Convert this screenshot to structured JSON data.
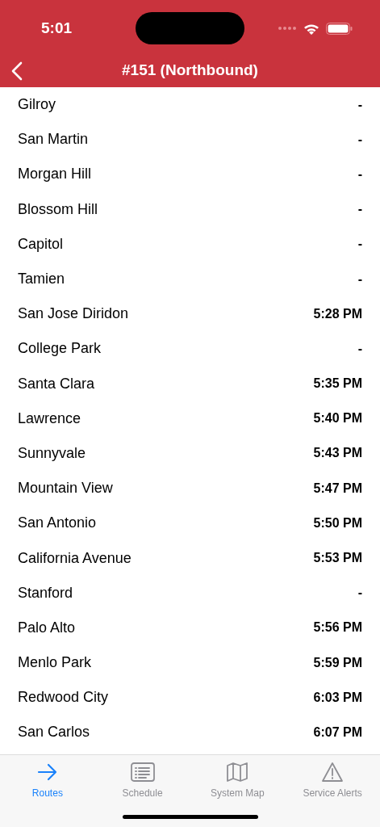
{
  "status_bar": {
    "time": "5:01"
  },
  "nav": {
    "title": "#151 (Northbound)"
  },
  "stops": [
    {
      "name": "Gilroy",
      "time": "-"
    },
    {
      "name": "San Martin",
      "time": "-"
    },
    {
      "name": "Morgan Hill",
      "time": "-"
    },
    {
      "name": "Blossom Hill",
      "time": "-"
    },
    {
      "name": "Capitol",
      "time": "-"
    },
    {
      "name": "Tamien",
      "time": "-"
    },
    {
      "name": "San Jose Diridon",
      "time": "5:28 PM"
    },
    {
      "name": "College Park",
      "time": "-"
    },
    {
      "name": "Santa Clara",
      "time": "5:35 PM"
    },
    {
      "name": "Lawrence",
      "time": "5:40 PM"
    },
    {
      "name": "Sunnyvale",
      "time": "5:43 PM"
    },
    {
      "name": "Mountain View",
      "time": "5:47 PM"
    },
    {
      "name": "San Antonio",
      "time": "5:50 PM"
    },
    {
      "name": "California Avenue",
      "time": "5:53 PM"
    },
    {
      "name": "Stanford",
      "time": "-"
    },
    {
      "name": "Palo Alto",
      "time": "5:56 PM"
    },
    {
      "name": "Menlo Park",
      "time": "5:59 PM"
    },
    {
      "name": "Redwood City",
      "time": "6:03 PM"
    },
    {
      "name": "San Carlos",
      "time": "6:07 PM"
    }
  ],
  "tab_bar": [
    {
      "label": "Routes",
      "kind": "arrow",
      "selected": true
    },
    {
      "label": "Schedule",
      "kind": "list",
      "selected": false
    },
    {
      "label": "System Map",
      "kind": "map",
      "selected": false
    },
    {
      "label": "Service Alerts",
      "kind": "alert",
      "selected": false
    }
  ]
}
